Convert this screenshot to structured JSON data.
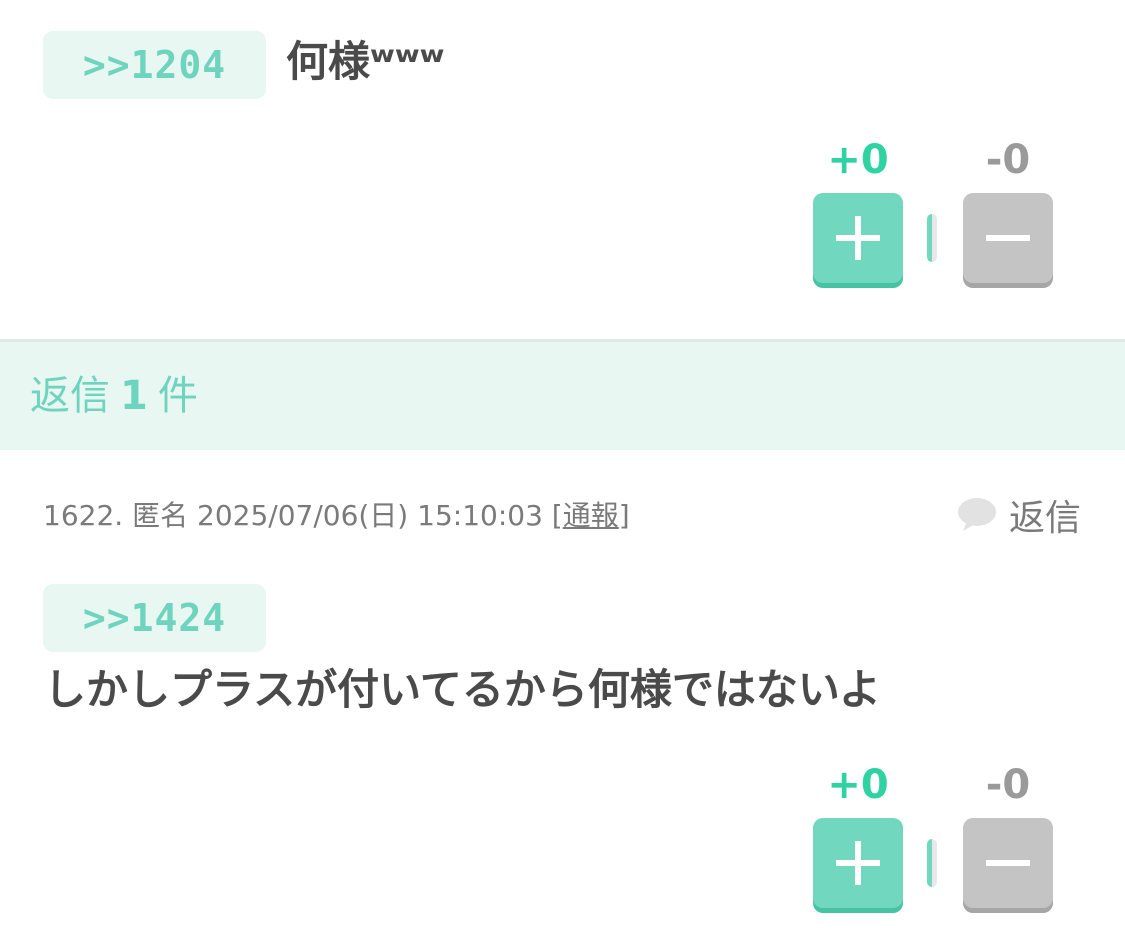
{
  "posts": [
    {
      "anchor": ">>1204",
      "body": "何様ʷʷʷ",
      "votes": {
        "plus": "+0",
        "minus": "-0",
        "ratio": 0.5
      }
    },
    {
      "meta": {
        "number": "1622.",
        "author": "匿名",
        "datetime": "2025/07/06(日) 15:10:03",
        "report_open": "[",
        "report": "通報",
        "report_close": "]"
      },
      "reply_label": "返信",
      "anchor": ">>1424",
      "body": "しかしプラスが付いてるから何様ではないよ",
      "votes": {
        "plus": "+0",
        "minus": "-0",
        "ratio": 0.5
      }
    }
  ],
  "replies_bar": {
    "prefix": "返信",
    "count": "1",
    "suffix": "件"
  },
  "colors": {
    "accent": "#72d7bf",
    "accent_text": "#2fd2a3",
    "chip_bg": "#e8f7f2",
    "minus": "#c4c4c4"
  }
}
